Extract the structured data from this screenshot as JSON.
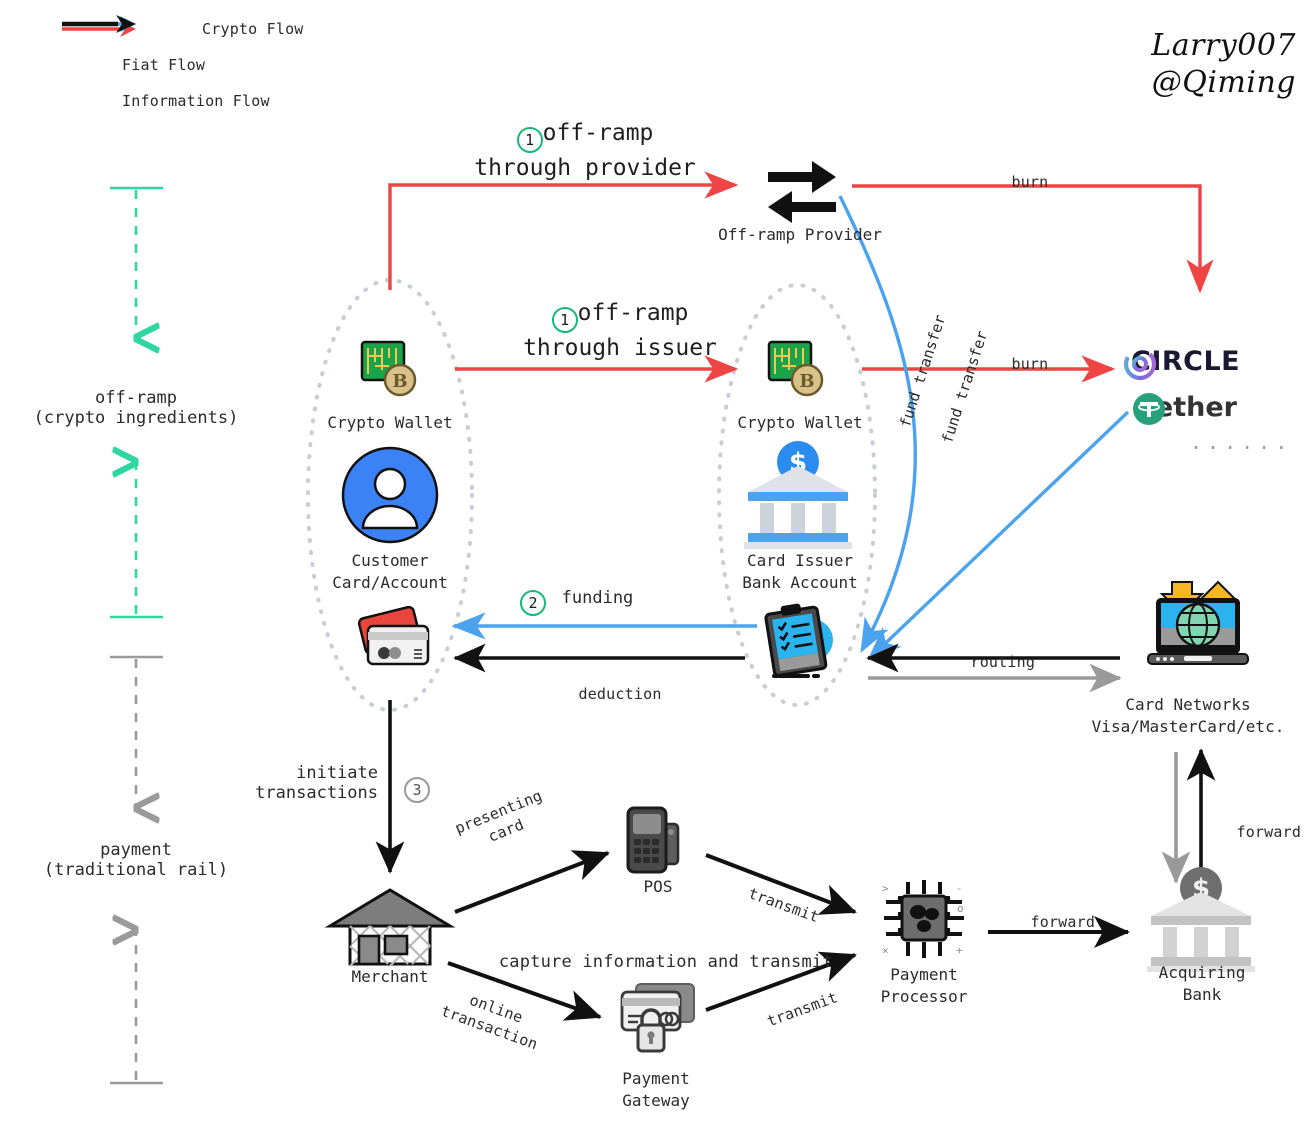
{
  "legend": {
    "items": [
      {
        "label": "Crypto Flow",
        "color": "#ef4444",
        "icon": "arrow-right-icon"
      },
      {
        "label": "Fiat Flow",
        "color": "#4ba3ef",
        "icon": "arrow-right-icon"
      },
      {
        "label": "Information Flow",
        "color": "#111111",
        "icon": "arrow-right-icon"
      }
    ]
  },
  "signature": {
    "line1": "Larry007",
    "line2": "@Qiming"
  },
  "axis": {
    "crypto": {
      "line1": "off-ramp",
      "line2": "(crypto ingredients)",
      "color": "#2fd6a0"
    },
    "payment": {
      "line1": "payment",
      "line2": "(traditional rail)",
      "color": "#9a9a9a"
    }
  },
  "steps": {
    "one_provider": {
      "num": "1",
      "line1": "off-ramp",
      "line2": "through provider"
    },
    "one_issuer": {
      "num": "1",
      "line1": "off-ramp",
      "line2": "through issuer"
    },
    "two_funding": {
      "num": "2",
      "label": "funding"
    },
    "three_initiate": {
      "num": "3",
      "line1": "initiate",
      "line2": "transactions"
    }
  },
  "nodes": {
    "offramp_provider": {
      "label": "Off-ramp Provider",
      "icon": "exchange-arrows-icon"
    },
    "customer_wallet": {
      "label": "Crypto Wallet",
      "icon": "crypto-wallet-icon"
    },
    "customer_account": {
      "line1": "Customer",
      "line2": "Card/Account",
      "icon": "user-avatar-icon",
      "card_icon": "credit-cards-icon"
    },
    "issuer_wallet": {
      "label": "Crypto Wallet",
      "icon": "crypto-wallet-icon"
    },
    "issuer_bank": {
      "line1": "Card Issuer",
      "line2": "Bank Account",
      "icon": "bank-icon",
      "ledger_icon": "clipboard-checklist-icon"
    },
    "circle": {
      "label": "CIRCLE",
      "icon": "circle-logo-icon"
    },
    "tether": {
      "label": "tether",
      "icon": "tether-logo-icon"
    },
    "more_stablecoins": {
      "label": "......"
    },
    "card_networks": {
      "line1": "Card Networks",
      "line2": "Visa/MasterCard/etc.",
      "icon": "laptop-globe-icon"
    },
    "merchant": {
      "label": "Merchant",
      "icon": "merchant-shop-icon"
    },
    "pos": {
      "label": "POS",
      "icon": "pos-terminal-icon"
    },
    "payment_gateway": {
      "line1": "Payment",
      "line2": "Gateway",
      "icon": "secure-card-lock-icon"
    },
    "payment_processor": {
      "line1": "Payment",
      "line2": "Processor",
      "icon": "chip-icon"
    },
    "acquiring_bank": {
      "line1": "Acquiring",
      "line2": "Bank",
      "icon": "bank-gray-icon"
    }
  },
  "edges": {
    "burn_top": "burn",
    "burn_mid": "burn",
    "fund_transfer_1": "fund transfer",
    "fund_transfer_2": "fund transfer",
    "routing": "routing",
    "deduction": "deduction",
    "forward_bank_network": "forward",
    "presenting_card": {
      "line1": "presenting",
      "line2": "card"
    },
    "capture_transmit": "capture information and transmit",
    "online_transaction": {
      "line1": "online",
      "line2": "transaction"
    },
    "transmit_pos": "transmit",
    "transmit_gateway": "transmit",
    "forward_processor": "forward"
  },
  "colors": {
    "crypto": "#ef4444",
    "fiat": "#4ba3ef",
    "info": "#111111",
    "accent_green": "#17b978",
    "axis_green": "#2fd6a0",
    "gray": "#9a9a9a"
  }
}
